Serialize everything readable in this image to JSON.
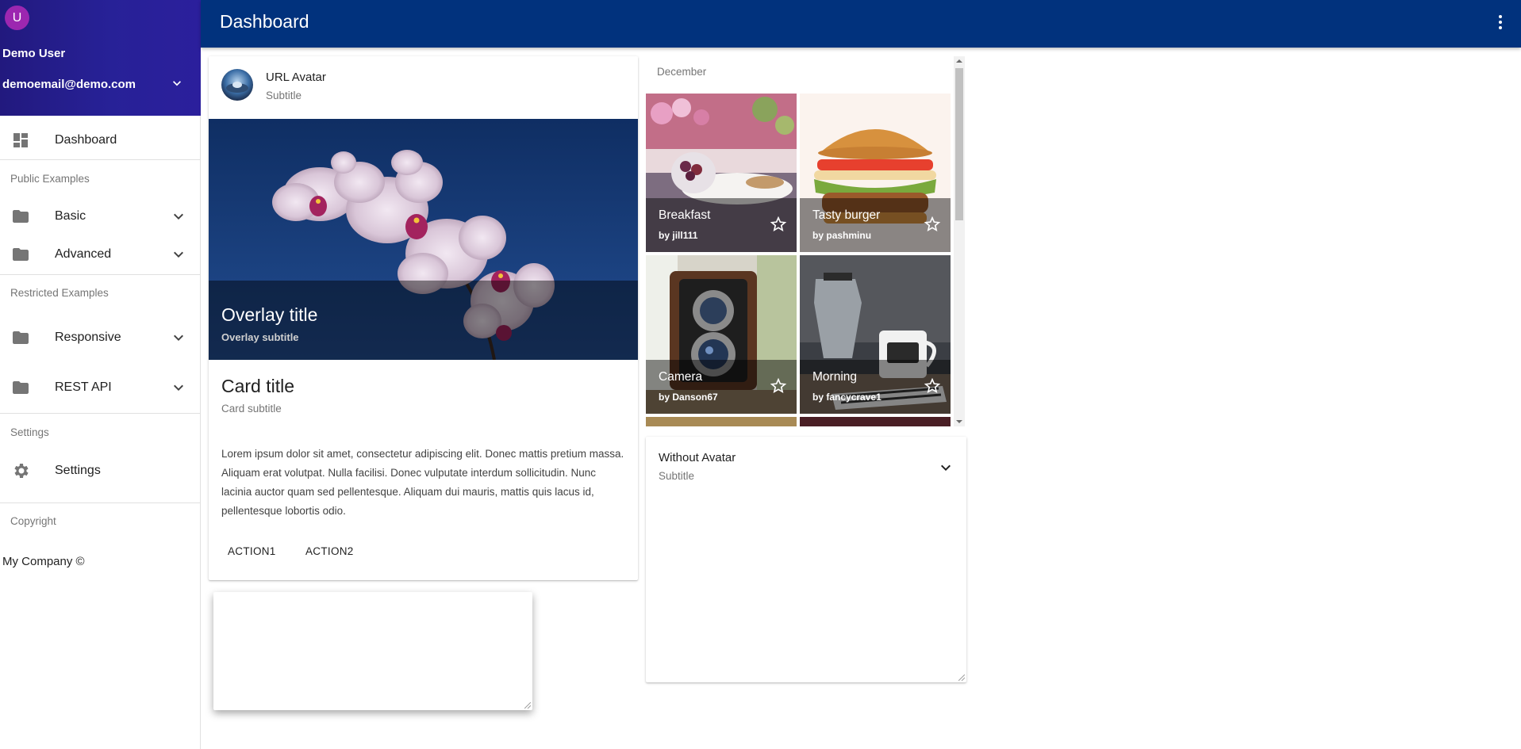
{
  "sidebar": {
    "avatar_letter": "U",
    "username": "Demo User",
    "email": "demoemail@demo.com",
    "items": {
      "dashboard": "Dashboard",
      "public_header": "Public Examples",
      "basic": "Basic",
      "advanced": "Advanced",
      "restricted_header": "Restricted Examples",
      "responsive": "Responsive",
      "rest_api": "REST API",
      "settings_header": "Settings",
      "settings": "Settings",
      "copyright_header": "Copyright",
      "copyright": "My Company ©"
    }
  },
  "topbar": {
    "title": "Dashboard"
  },
  "main_card": {
    "header_title": "URL Avatar",
    "header_subtitle": "Subtitle",
    "overlay_title": "Overlay title",
    "overlay_subtitle": "Overlay subtitle",
    "title": "Card title",
    "subtitle": "Card subtitle",
    "body": "Lorem ipsum dolor sit amet, consectetur adipiscing elit. Donec mattis pretium massa. Aliquam erat volutpat. Nulla facilisi. Donec vulputate interdum sollicitudin. Nunc lacinia auctor quam sed pellentesque. Aliquam dui mauris, mattis quis lacus id, pellentesque lobortis odio.",
    "action1": "ACTION1",
    "action2": "ACTION2"
  },
  "grid": {
    "subheader": "December",
    "tiles": [
      {
        "title": "Breakfast",
        "author": "jill111"
      },
      {
        "title": "Tasty burger",
        "author": "pashminu"
      },
      {
        "title": "Camera",
        "author": "Danson67"
      },
      {
        "title": "Morning",
        "author": "fancycrave1"
      }
    ],
    "by_prefix": "by"
  },
  "expand_card": {
    "title": "Without Avatar",
    "subtitle": "Subtitle"
  },
  "colors": {
    "header": "#22197e",
    "topbar": "#01327d",
    "avatar": "#9c27b0"
  }
}
